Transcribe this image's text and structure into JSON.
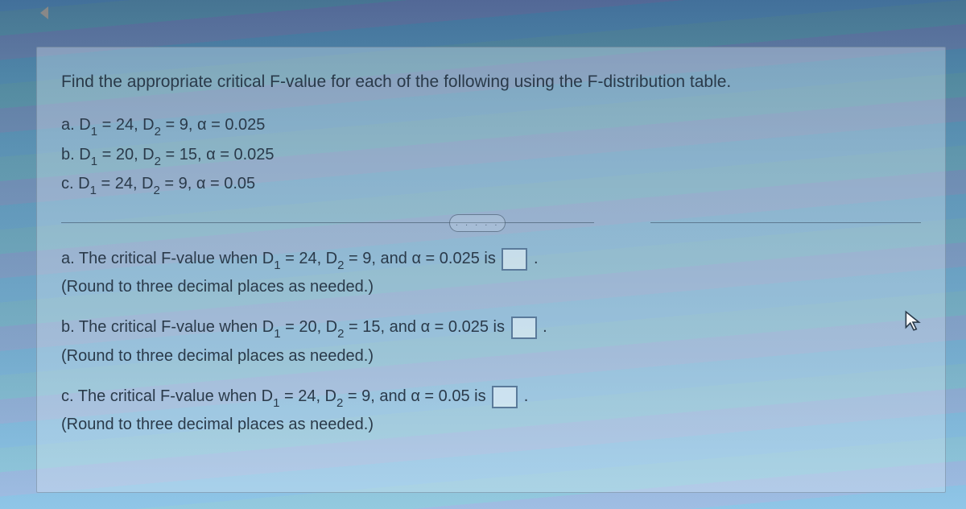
{
  "navigation": {
    "back_label": "back"
  },
  "prompt": "Find the appropriate critical F-value for each of the following using the F-distribution table.",
  "params": {
    "a": "a. D₁ = 24, D₂ = 9, α = 0.025",
    "b": "b. D₁ = 20, D₂ = 15, α = 0.025",
    "c": "c. D₁ = 24, D₂ = 9, α = 0.05"
  },
  "divider": {
    "dots": ". . . . ."
  },
  "answers": {
    "a": {
      "text_before": "a. The critical F-value when D₁ = 24, D₂ = 9, and α = 0.025 is ",
      "input_value": "",
      "text_after": ".",
      "note": "(Round to three decimal places as needed.)"
    },
    "b": {
      "text_before": "b. The critical F-value when D₁ = 20, D₂ = 15, and α = 0.025 is ",
      "input_value": "",
      "text_after": ".",
      "note": "(Round to three decimal places as needed.)"
    },
    "c": {
      "text_before": "c. The critical F-value when D₁ = 24, D₂ = 9, and α = 0.05 is ",
      "input_value": "",
      "text_after": ".",
      "note": "(Round to three decimal places as needed.)"
    }
  }
}
